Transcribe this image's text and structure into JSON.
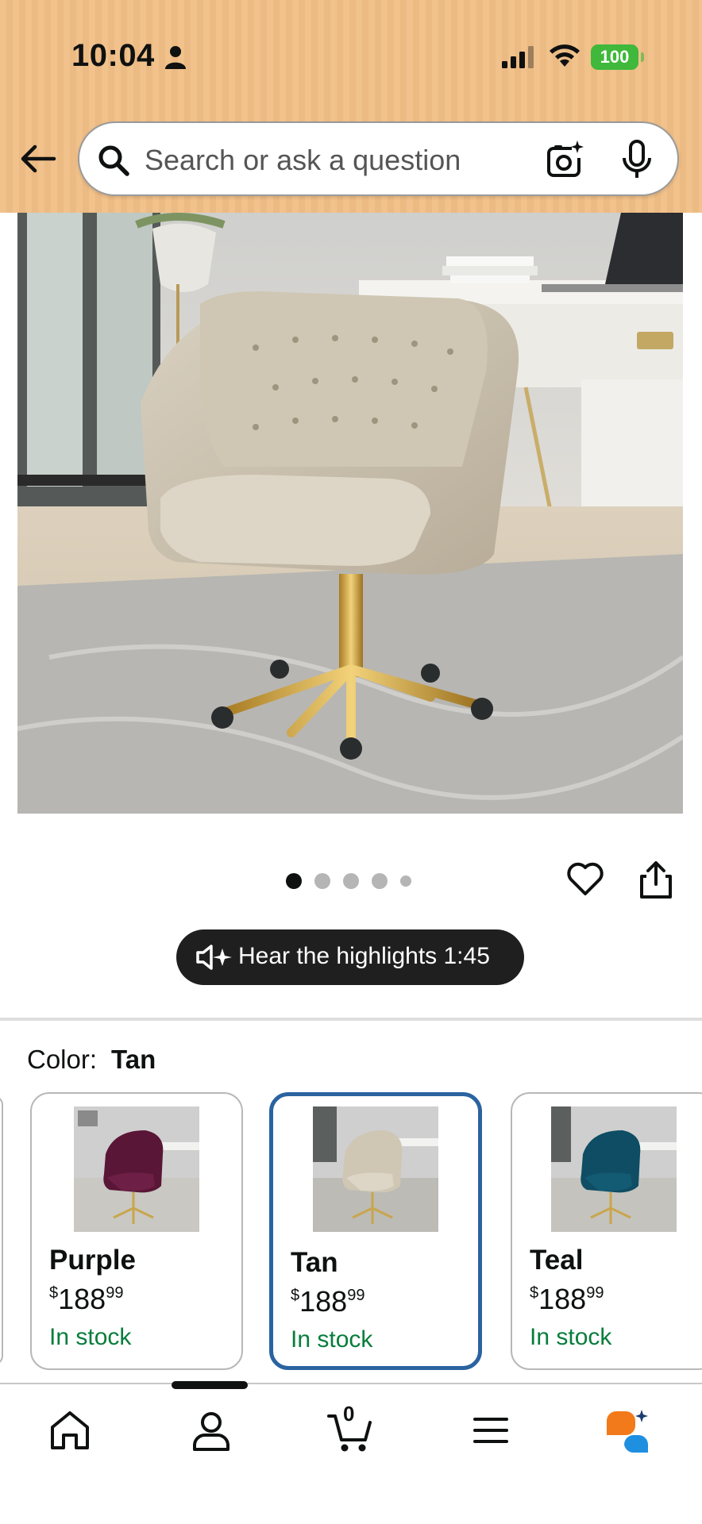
{
  "status_bar": {
    "time": "10:04",
    "battery": "100"
  },
  "search": {
    "placeholder": "Search or ask a question"
  },
  "gallery": {
    "dot_count": 5,
    "active_index": 0
  },
  "audio": {
    "label": "Hear the highlights 1:45"
  },
  "color_selector": {
    "label": "Color:",
    "selected": "Tan",
    "options": [
      {
        "name": "Purple",
        "price_currency": "$",
        "price_whole": "188",
        "price_fraction": "99",
        "stock": "In stock"
      },
      {
        "name": "Tan",
        "price_currency": "$",
        "price_whole": "188",
        "price_fraction": "99",
        "stock": "In stock"
      },
      {
        "name": "Teal",
        "price_currency": "$",
        "price_whole": "188",
        "price_fraction": "99",
        "stock": "In stock"
      }
    ]
  },
  "bottom_nav": {
    "cart_count": "0",
    "items": [
      "home-icon",
      "account-icon",
      "cart-icon",
      "menu-icon",
      "rufus-assistant-icon"
    ]
  },
  "colors": {
    "header_bg": "#f1c28c",
    "selected_border": "#2a63a0",
    "in_stock": "#077d3c",
    "hear_button_bg": "#1f1f1f",
    "battery_green": "#3fb83b",
    "assistant_orange": "#f27a1a",
    "assistant_blue": "#1f8fe0"
  }
}
